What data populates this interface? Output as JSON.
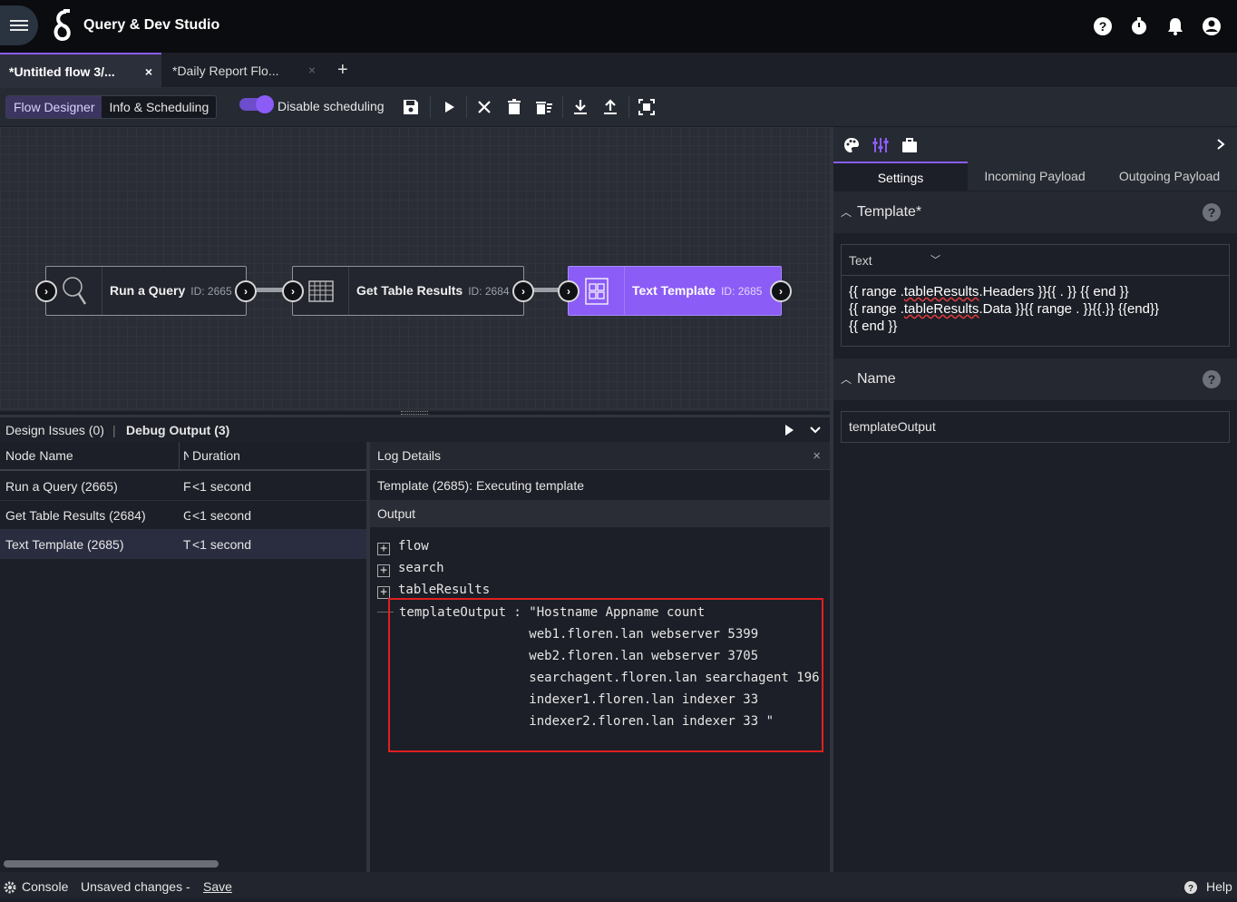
{
  "app": {
    "title": "Query & Dev Studio"
  },
  "tabs": [
    {
      "label": "*Untitled flow 3/...",
      "close": "×"
    },
    {
      "label": "*Daily Report Flo...",
      "close": "×"
    }
  ],
  "tab_add": "+",
  "toolbar": {
    "flow_designer": "Flow Designer",
    "info_scheduling": "Info & Scheduling",
    "disable_scheduling": "Disable scheduling"
  },
  "nodes": [
    {
      "name": "Run a Query",
      "id": "ID: 2665",
      "icon": "search-icon"
    },
    {
      "name": "Get Table Results",
      "id": "ID: 2684",
      "icon": "table-icon"
    },
    {
      "name": "Text Template",
      "id": "ID: 2685",
      "icon": "template-icon"
    }
  ],
  "bottom": {
    "design_issues": "Design Issues (0)",
    "debug_output": "Debug Output (3)",
    "columns": {
      "node_name": "Node Name",
      "n": "N",
      "duration": "Duration"
    },
    "rows": [
      {
        "name": "Run a Query (2665)",
        "n": "F",
        "duration": "<1 second"
      },
      {
        "name": "Get Table Results (2684)",
        "n": "G",
        "duration": "<1 second"
      },
      {
        "name": "Text Template (2685)",
        "n": "T",
        "duration": "<1 second"
      }
    ]
  },
  "log": {
    "title": "Log Details",
    "close": "×",
    "message": "Template (2685): Executing template",
    "output_label": "Output",
    "tree": [
      "flow",
      "search",
      "tableResults"
    ],
    "template_output": "templateOutput : \"Hostname Appname count\n                 web1.floren.lan webserver 5399\n                 web2.floren.lan webserver 3705\n                 searchagent.floren.lan searchagent 196\n                 indexer1.floren.lan indexer 33\n                 indexer2.floren.lan indexer 33 \""
  },
  "right_panel": {
    "tabs": [
      "Settings",
      "Incoming Payload",
      "Outgoing Payload"
    ],
    "template_section": "Template*",
    "template_type": "Text",
    "template_lines": [
      "{{ range .tableResults.Headers }}{{ . }} {{ end }}",
      "{{ range .tableResults.Data }}{{ range . }}{{.}} {{end}}",
      "{{ end }}"
    ],
    "name_section": "Name",
    "name_value": "templateOutput",
    "help": "?"
  },
  "status": {
    "console": "Console",
    "unsaved": "Unsaved changes -",
    "save": "Save",
    "help": "Help"
  },
  "colors": {
    "accent": "#8b5cf6",
    "highlight": "#e02020"
  }
}
